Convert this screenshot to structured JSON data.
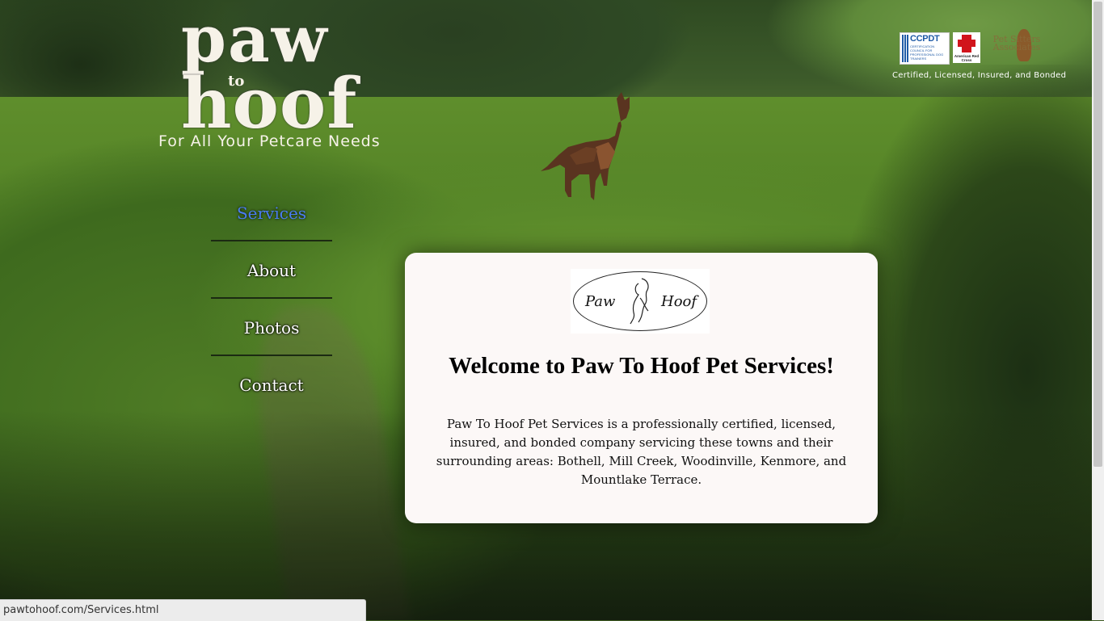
{
  "logo": {
    "line1": "paw",
    "line2": "to",
    "line3": "hoof",
    "tagline": "For All Your Petcare Needs"
  },
  "badges": {
    "ccpdt_title": "CCPDT",
    "ccpdt_subtitle": "CERTIFICATION COUNCIL FOR PROFESSIONAL DOG TRAINERS",
    "redcross_label": "American Red Cross",
    "psa_label": "Pet Sitters Associates",
    "caption": "Certified, Licensed, Insured, and Bonded"
  },
  "nav": {
    "items": [
      {
        "label": "Services",
        "active": true
      },
      {
        "label": "About",
        "active": false
      },
      {
        "label": "Photos",
        "active": false
      },
      {
        "label": "Contact",
        "active": false
      }
    ]
  },
  "main": {
    "emblem_left": "Paw",
    "emblem_right": "Hoof",
    "heading": "Welcome to Paw To Hoof Pet Services!",
    "description": "Paw To Hoof Pet Services is a professionally certified, licensed, insured, and bonded company servicing these towns and their surrounding areas: Bothell, Mill Creek, Woodinville, Kenmore, and Mountlake Terrace."
  },
  "status_bar": {
    "url": "pawtohoof.com/Services.html"
  },
  "colors": {
    "active_nav": "#4a7cf0",
    "card_background": "#fcf8f7",
    "text_light": "#ffffff"
  }
}
